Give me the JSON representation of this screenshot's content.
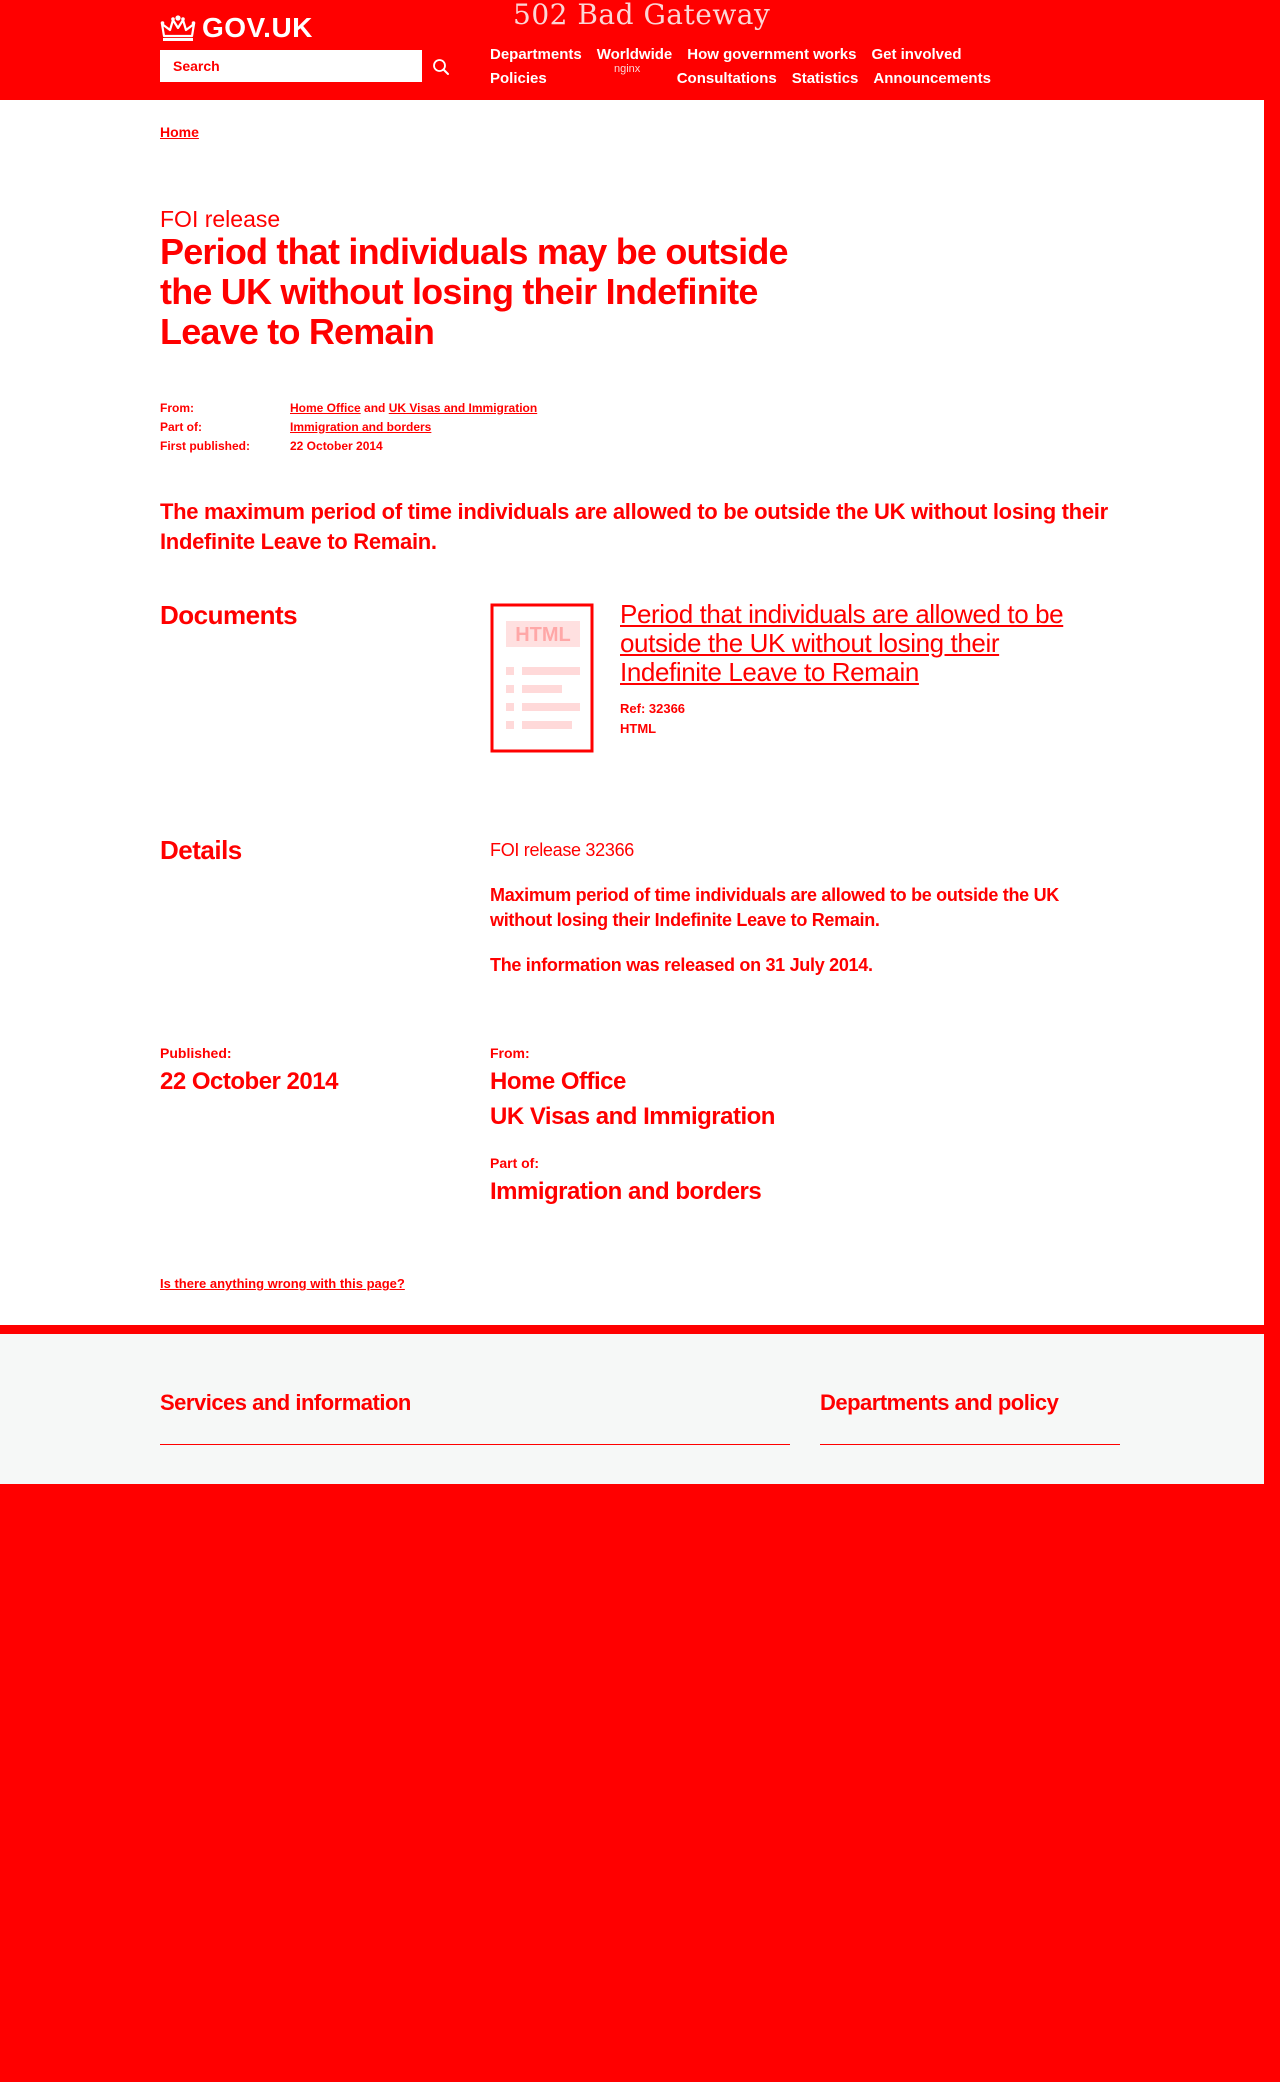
{
  "header": {
    "logo_text": "GOV.UK",
    "error_title": "502 Bad Gateway",
    "error_server": "nginx",
    "search_placeholder": "Search",
    "nav_row1": [
      "Departments",
      "Worldwide",
      "How government works",
      "Get involved"
    ],
    "nav_row2": [
      "Policies",
      "Consultations",
      "Statistics",
      "Announcements"
    ]
  },
  "breadcrumb": {
    "home": "Home"
  },
  "page": {
    "doc_type": "FOI release",
    "title": "Period that individuals may be outside the UK without losing their Indefinite Leave to Remain",
    "summary": "The maximum period of time individuals are allowed to be outside the UK without losing their Indefinite Leave to Remain."
  },
  "metadata": {
    "from_label": "From:",
    "from_org1": "Home Office",
    "from_and": "and",
    "from_org2": "UK Visas and Immigration",
    "partof_label": "Part of:",
    "partof_value": "Immigration and borders",
    "first_published_label": "First published:",
    "first_published_value": "22 October 2014"
  },
  "documents": {
    "heading": "Documents",
    "thumb_label": "HTML",
    "link_title": "Period that individuals are allowed to be outside the UK without losing their Indefinite Leave to Remain",
    "ref": "Ref: 32366",
    "format": "HTML"
  },
  "details": {
    "heading": "Details",
    "paragraphs": [
      "FOI release 32366",
      "Maximum period of time individuals are allowed to be outside the UK without losing their Indefinite Leave to Remain.",
      "The information was released on 31 July 2014."
    ]
  },
  "published_block": {
    "published_label": "Published:",
    "published_value": "22 October 2014",
    "from_label": "From:",
    "from_org1": "Home Office",
    "from_org2": "UK Visas and Immigration",
    "partof_label": "Part of:",
    "partof_value": "Immigration and borders"
  },
  "report_link": "Is there anything wrong with this page?",
  "footer": {
    "services_heading": "Services and information",
    "departments_heading": "Departments and policy"
  },
  "colors": {
    "primary": "#ff0000",
    "panel": "#ffffff",
    "footer_bg": "#f6f8f7"
  }
}
